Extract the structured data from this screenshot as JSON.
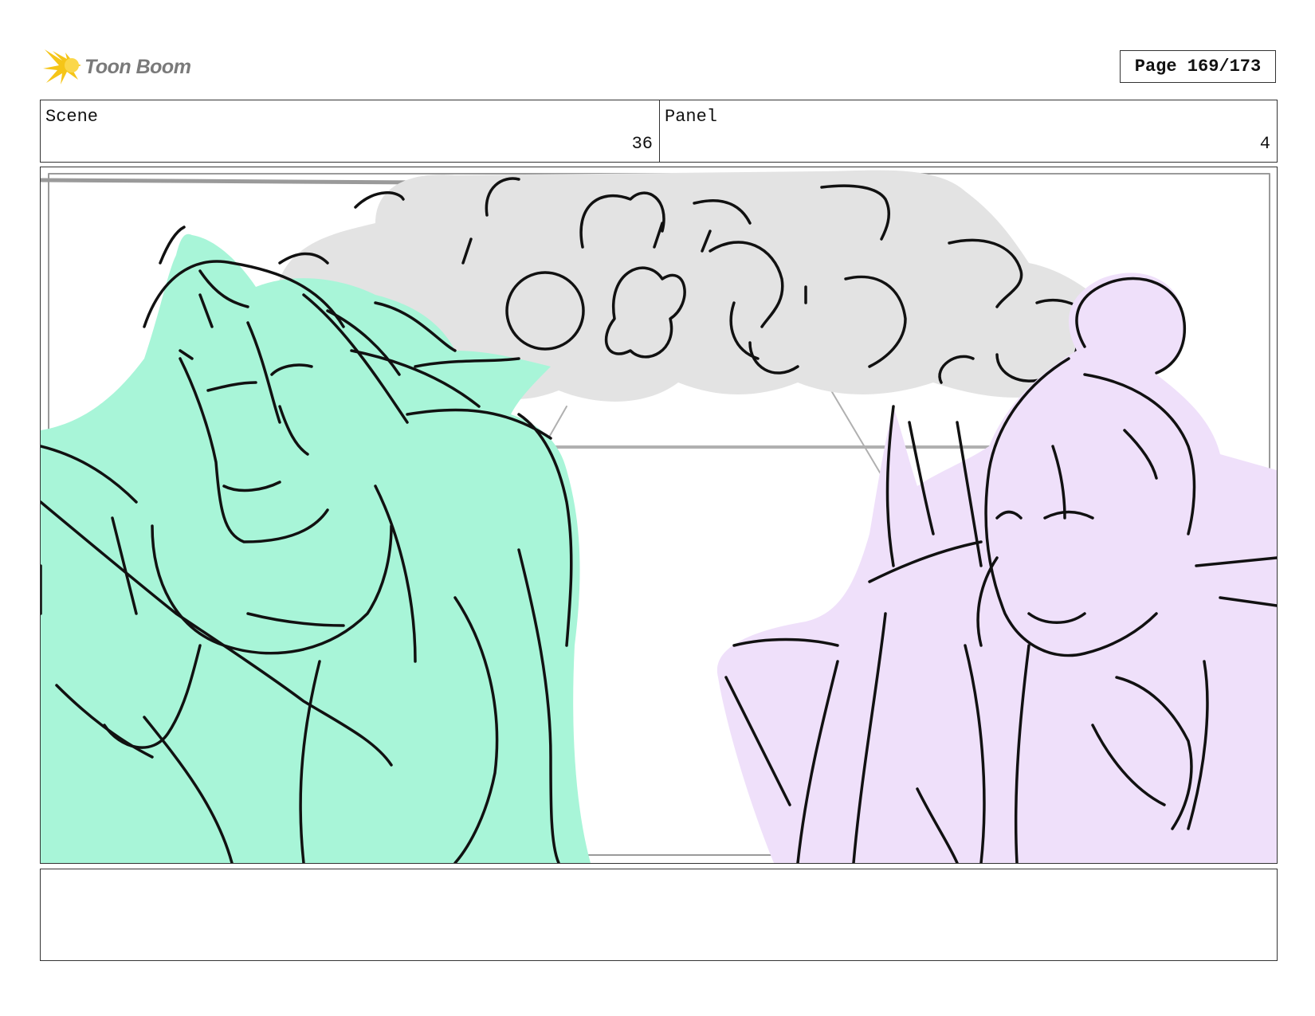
{
  "header": {
    "logo_text": "Toon Boom",
    "page_label": "Page 169/173"
  },
  "info": {
    "scene_label": "Scene",
    "scene_value": "36",
    "panel_label": "Panel",
    "panel_value": "4"
  },
  "colors": {
    "left_character_fill": "#a8f5d8",
    "right_character_fill": "#efe0fa",
    "smoke_fill": "#e3e3e3",
    "line": "#111111",
    "logo_accent": "#f5c518"
  },
  "notes": {
    "text": ""
  }
}
